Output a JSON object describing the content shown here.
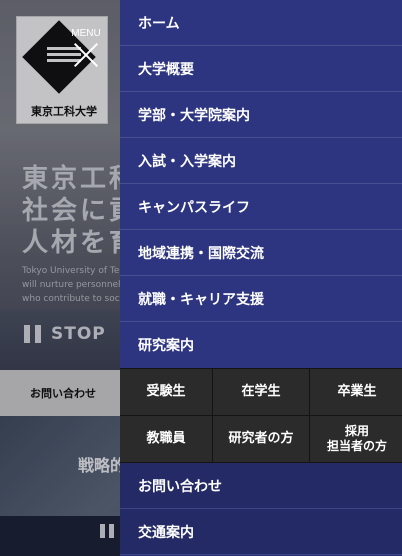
{
  "background": {
    "logo_text": "東京工科大学",
    "hero_lines": [
      "東京工科",
      "社会に貢",
      "人材を育"
    ],
    "hero_en_lines": [
      "Tokyo University of Te",
      "will nurture personnel",
      "who contribute to soci"
    ],
    "stop_label": "STOP",
    "contact_label": "お問い合わせ",
    "strategy_text": "戦略的"
  },
  "menu_button": {
    "label": "MENU"
  },
  "menu": {
    "items": [
      {
        "label": "ホーム"
      },
      {
        "label": "大学概要"
      },
      {
        "label": "学部・大学院案内"
      },
      {
        "label": "入試・入学案内"
      },
      {
        "label": "キャンパスライフ"
      },
      {
        "label": "地域連携・国際交流"
      },
      {
        "label": "就職・キャリア支援"
      },
      {
        "label": "研究案内"
      }
    ],
    "sub_items": [
      {
        "label": "受験生"
      },
      {
        "label": "在学生"
      },
      {
        "label": "卒業生"
      },
      {
        "label": "教職員"
      },
      {
        "label": "研究者の方"
      },
      {
        "label": "採用\n担当者の方"
      }
    ],
    "footer_items": [
      {
        "label": "お問い合わせ"
      },
      {
        "label": "交通案内"
      }
    ]
  },
  "colors": {
    "menu_bg": "#2e3580",
    "sub_bg": "#2b2b2b",
    "footer_bg": "#232a66"
  }
}
